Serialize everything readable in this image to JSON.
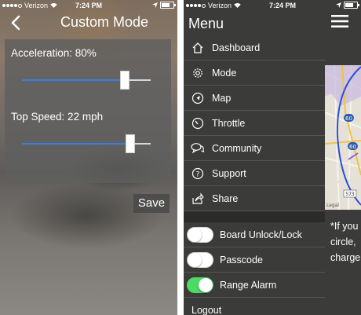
{
  "status_bar": {
    "carrier": "Verizon",
    "time": "7:24 PM"
  },
  "custom_mode": {
    "title": "Custom Mode",
    "acceleration": {
      "label": "Acceleration: 80%",
      "value": 0.8
    },
    "top_speed": {
      "label": "Top Speed: 22 mph",
      "value": 0.84
    },
    "save_label": "Save",
    "accent_color": "#3a7fe0"
  },
  "menu": {
    "title": "Menu",
    "items": [
      {
        "label": "Dashboard",
        "icon": "home-icon"
      },
      {
        "label": "Mode",
        "icon": "gear-icon"
      },
      {
        "label": "Map",
        "icon": "compass-icon"
      },
      {
        "label": "Throttle",
        "icon": "gauge-icon"
      },
      {
        "label": "Community",
        "icon": "chat-icon"
      },
      {
        "label": "Support",
        "icon": "help-icon"
      },
      {
        "label": "Share",
        "icon": "share-icon"
      }
    ],
    "toggles": [
      {
        "label": "Board Unlock/Lock",
        "on": false
      },
      {
        "label": "Passcode",
        "on": false
      },
      {
        "label": "Range Alarm",
        "on": true
      }
    ],
    "logout_label": "Logout",
    "toggle_on_color": "#4cd964"
  },
  "background_screen": {
    "text_lines": [
      "*If you",
      "circle,",
      "charge"
    ],
    "map_labels": [
      "60",
      "60",
      "573"
    ],
    "map_legal": "Legal"
  }
}
